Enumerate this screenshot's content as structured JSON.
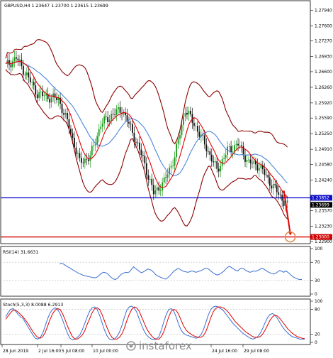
{
  "chart_data": [
    {
      "type": "candlestick",
      "title": "GBPUSD,H4  1.23647 1.23700 1.23615 1.23699",
      "price_axis": [
        "1.27940",
        "1.27600",
        "1.27270",
        "1.26930",
        "1.26600",
        "1.26260",
        "1.25920",
        "1.25590",
        "1.25250",
        "1.24910",
        "1.24580",
        "1.24240",
        "1.23570",
        "1.23230",
        "1.22900"
      ],
      "ylim": [
        1.229,
        1.281
      ],
      "blue_level": {
        "label": "1.23852",
        "value": 1.23852
      },
      "current_price": {
        "label": "1.23699",
        "value": 1.23699
      },
      "red_level": {
        "label": "1.23000",
        "value": 1.23
      },
      "x_ticks": [
        "28 Jun 2019",
        "2 Jul 16:00",
        "5 Jul 08:00",
        "10 Jul 00:00",
        "24 Jul 16:00",
        "29 Jul 08:00"
      ],
      "colors": {
        "bull": "#1a9b1a",
        "bear": "#111111",
        "bands": "#8b0000",
        "ma_fast": "#e00000",
        "ma_slow": "#4a86d8",
        "blue_line": "#0000cc",
        "red_line": "#d40000",
        "arrow": "#e00000",
        "target_circle": "#e0904a"
      }
    },
    {
      "type": "line",
      "title": "RSI(14) 31.6631",
      "ylim": [
        0,
        100
      ],
      "y_ticks": [
        "100",
        "70",
        "30",
        "0"
      ],
      "series": [
        {
          "name": "RSI(14)",
          "values": [
            66,
            68,
            66,
            63,
            60,
            58,
            55,
            52,
            50,
            47,
            45,
            43,
            41,
            40,
            39,
            38,
            37,
            36,
            36,
            38,
            42,
            46,
            48,
            47,
            45,
            40,
            36,
            33,
            32,
            35,
            40,
            44,
            46,
            48,
            47,
            49,
            55,
            60,
            56,
            53,
            49,
            47,
            49,
            52,
            55,
            54,
            52,
            48,
            43,
            40,
            38,
            36,
            34,
            33,
            36,
            40,
            45,
            50,
            53,
            56,
            55,
            52,
            50,
            49,
            48,
            49,
            51,
            50,
            48,
            49,
            51,
            52,
            55,
            57,
            56,
            53,
            49,
            46,
            43,
            42,
            44,
            47,
            50,
            55,
            59,
            61,
            58,
            55,
            52,
            51,
            55,
            57,
            56,
            52,
            50,
            48,
            49,
            51,
            50,
            52,
            54,
            57,
            55,
            52,
            49,
            47,
            45,
            44,
            46,
            49,
            52,
            50,
            48,
            51,
            48,
            44,
            40,
            37,
            35,
            33,
            32,
            32
          ]
        }
      ]
    },
    {
      "type": "line",
      "title": "Stoch(5,3,3) 8.0088 6.2913",
      "ylim": [
        0,
        100
      ],
      "y_ticks": [
        "100",
        "80",
        "20",
        "0"
      ],
      "series": [
        {
          "name": "Stoch main",
          "values": [
            62,
            72,
            80,
            82,
            76,
            68,
            62,
            58,
            48,
            38,
            28,
            18,
            10,
            8,
            12,
            22,
            40,
            58,
            72,
            80,
            84,
            80,
            70,
            55,
            38,
            22,
            10,
            6,
            8,
            12,
            18,
            30,
            46,
            62,
            76,
            84,
            86,
            80,
            66,
            48,
            30,
            16,
            8,
            6,
            8,
            14,
            24,
            40,
            60,
            78,
            86,
            88,
            84,
            74,
            58,
            42,
            28,
            18,
            12,
            8,
            6,
            8,
            14,
            30,
            50,
            68,
            80,
            82,
            76,
            62,
            44,
            30,
            22,
            18,
            16,
            14,
            12,
            10,
            12,
            18,
            30,
            48,
            66,
            80,
            86,
            88,
            86,
            82,
            78,
            70,
            62,
            54,
            46,
            40,
            34,
            28,
            22,
            18,
            14,
            10,
            8,
            10,
            14,
            22,
            34,
            48,
            60,
            68,
            70,
            66,
            58,
            48,
            38,
            30,
            24,
            18,
            14,
            12,
            10,
            8,
            8,
            8
          ]
        },
        {
          "name": "Stoch signal",
          "values": [
            56,
            64,
            72,
            78,
            78,
            74,
            68,
            62,
            54,
            46,
            36,
            26,
            18,
            12,
            10,
            14,
            24,
            40,
            56,
            70,
            78,
            82,
            80,
            70,
            56,
            40,
            26,
            14,
            8,
            8,
            12,
            18,
            28,
            44,
            58,
            72,
            82,
            84,
            80,
            68,
            52,
            36,
            22,
            12,
            8,
            8,
            12,
            20,
            34,
            52,
            68,
            80,
            86,
            84,
            76,
            62,
            48,
            34,
            24,
            16,
            10,
            8,
            8,
            14,
            26,
            44,
            62,
            76,
            80,
            78,
            68,
            54,
            40,
            30,
            24,
            20,
            16,
            14,
            12,
            12,
            16,
            26,
            42,
            60,
            74,
            82,
            86,
            86,
            84,
            80,
            74,
            66,
            58,
            50,
            44,
            38,
            32,
            26,
            22,
            18,
            14,
            12,
            12,
            14,
            20,
            30,
            42,
            54,
            62,
            66,
            64,
            58,
            50,
            42,
            34,
            28,
            22,
            18,
            14,
            12,
            10,
            9
          ]
        }
      ]
    }
  ],
  "watermark": "instaforex"
}
